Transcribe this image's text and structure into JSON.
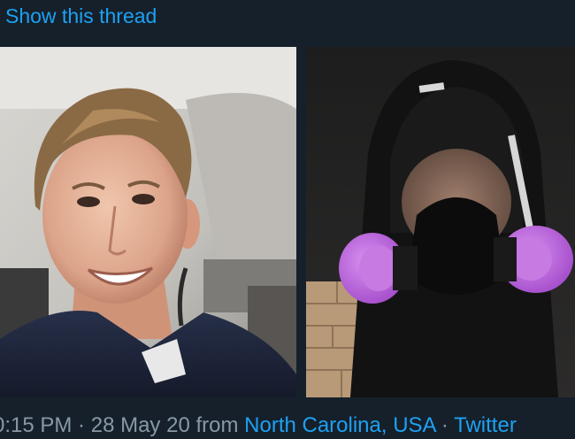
{
  "thread": {
    "link_label": "Show this thread"
  },
  "media": {
    "photos": [
      {
        "label": "Portrait of a smiling man in a dark uniform shirt inside a vehicle"
      },
      {
        "label": "Person wearing a black hood and a respirator mask with purple filters"
      }
    ]
  },
  "tweet_meta": {
    "time": "0:15 PM",
    "sep1": " · ",
    "date": "28 May 20",
    "from_label": " from ",
    "location": "North Carolina, USA",
    "sep2": " · ",
    "source": "Twitter"
  },
  "colors": {
    "background": "#15202b",
    "link": "#1da1f2",
    "muted_text": "#8899a6",
    "respirator_filter": "#b45ad6"
  }
}
